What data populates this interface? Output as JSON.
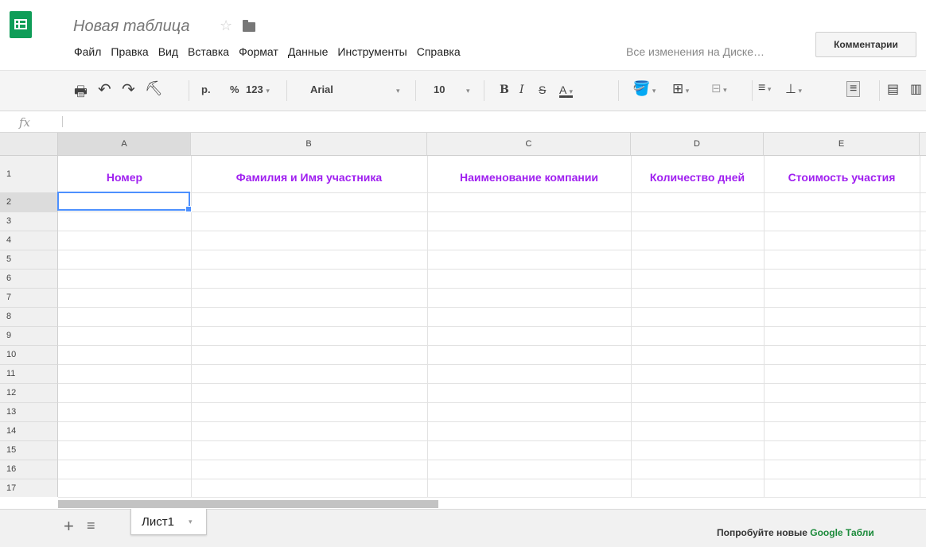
{
  "app": {
    "title": "Новая таблица",
    "star_icon": "star-outline-icon",
    "folder_icon": "folder-icon",
    "logo_icon": "sheets-logo-icon",
    "brand_color": "#0f9d58"
  },
  "menu": [
    "Файл",
    "Правка",
    "Вид",
    "Вставка",
    "Формат",
    "Данные",
    "Инструменты",
    "Справка"
  ],
  "save_status": "Все изменения на Диске…",
  "comments_label": "Комментарии",
  "toolbar": {
    "currency": "р.",
    "percent": "%",
    "number_format": "123",
    "font": "Arial",
    "font_size": "10",
    "bold": "B",
    "italic": "I",
    "strike": "S",
    "text_color": "A",
    "icons": [
      "print-icon",
      "undo-icon",
      "redo-icon",
      "paint-format-icon",
      "fill-color-icon",
      "borders-icon",
      "merge-cells-icon",
      "align-left-icon",
      "valign-bottom-icon",
      "wrap-text-icon",
      "comment-icon",
      "chart-icon"
    ]
  },
  "formula_bar": {
    "fx": "fx",
    "value": ""
  },
  "grid": {
    "columns": [
      "A",
      "B",
      "C",
      "D",
      "E"
    ],
    "rows": [
      "1",
      "2",
      "3",
      "4",
      "5",
      "6",
      "7",
      "8",
      "9",
      "10",
      "11",
      "12",
      "13",
      "14",
      "15",
      "16",
      "17"
    ],
    "header_cells": [
      "Номер",
      "Фамилия и Имя участника",
      "Наименование компании",
      "Количество дней",
      "Стоимость участия"
    ],
    "header_color": "#a020f0",
    "selected_cell": "A2"
  },
  "sheets": {
    "tabs": [
      "Лист1"
    ],
    "promo_prefix": "Попробуйте новые ",
    "promo_link": "Google Табли"
  }
}
